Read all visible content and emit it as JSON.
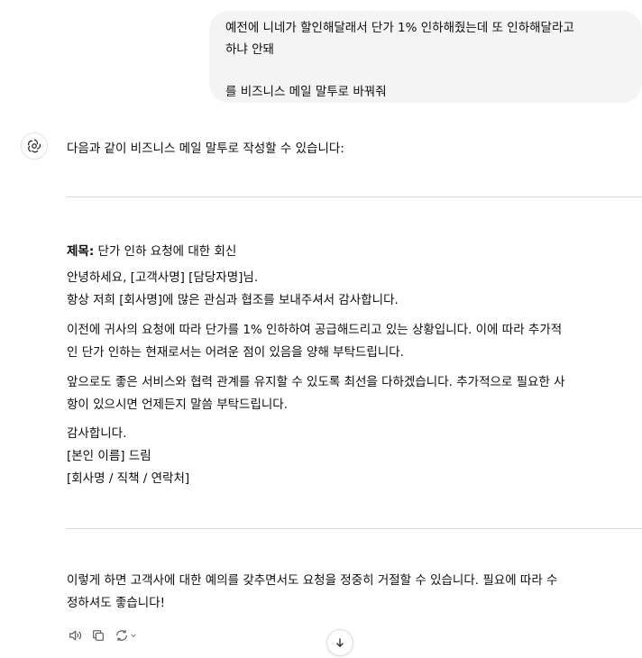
{
  "user_message": "예전에 니네가 할인해달래서 단가 1% 인하해줬는데 또 인하해달라고\n하냐 안돼\n\n를 비즈니스 메일 말투로 바꿔줘",
  "assistant": {
    "intro": "다음과 같이 비즈니스 메일 말투로 작성할 수 있습니다:",
    "email": {
      "subject_label": "제목:",
      "subject": " 단가 인하 요청에 대한 회신",
      "greeting_line1": "안녕하세요, [고객사명] [담당자명]님.",
      "greeting_line2": "항상 저희 [회사명]에 많은 관심과 협조를 보내주셔서 감사합니다.",
      "body1_line1": "이전에 귀사의 요청에 따라 단가를 1% 인하하여 공급해드리고 있는 상황입니다. 이에 따라 추가적",
      "body1_line2": "인 단가 인하는 현재로서는 어려운 점이 있음을 양해 부탁드립니다.",
      "body2_line1": "앞으로도 좋은 서비스와 협력 관계를 유지할 수 있도록 최선을 다하겠습니다. 추가적으로 필요한 사",
      "body2_line2": "항이 있으시면 언제든지 말씀 부탁드립니다.",
      "closing_line1": "감사합니다.",
      "closing_line2": "[본인 이름] 드림",
      "closing_line3": "[회사명 / 직책 / 연락처]"
    },
    "outro_line1": "이렇게 하면 고객사에 대한 예의를 갖추면서도 요청을 정중히 거절할 수 있습니다. 필요에 따라 수",
    "outro_line2": "정하셔도 좋습니다!"
  },
  "icons": {
    "assistant_avatar": "openai-logo-icon",
    "read_aloud": "speaker-icon",
    "copy": "copy-icon",
    "regenerate": "refresh-icon",
    "scroll_down": "arrow-down-icon"
  }
}
